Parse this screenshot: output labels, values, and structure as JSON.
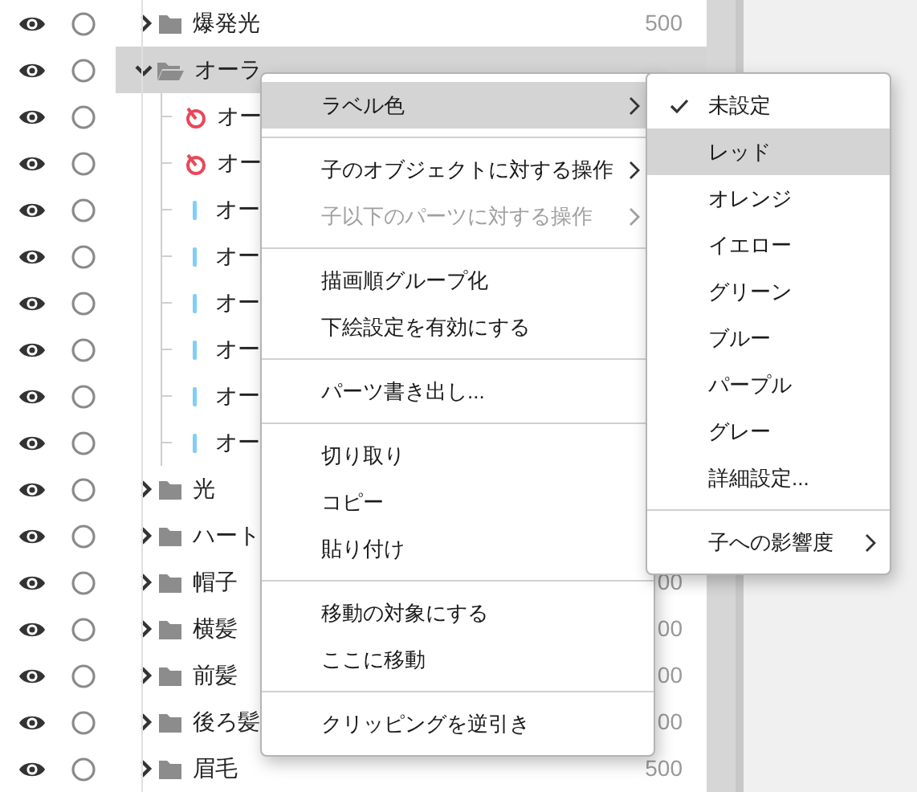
{
  "tree": {
    "rows": [
      {
        "kind": "folder",
        "visible": true,
        "expanded": false,
        "selected": false,
        "name": "爆発光",
        "value": "500"
      },
      {
        "kind": "folder",
        "visible": true,
        "expanded": true,
        "selected": true,
        "name": "オーラ",
        "children": [
          {
            "kind": "deformer",
            "visible": true,
            "selected": false,
            "name": "オー"
          },
          {
            "kind": "deformer",
            "visible": true,
            "selected": false,
            "name": "オー"
          },
          {
            "kind": "mesh",
            "visible": true,
            "selected": false,
            "name": "オー"
          },
          {
            "kind": "mesh",
            "visible": true,
            "selected": false,
            "name": "オー"
          },
          {
            "kind": "mesh",
            "visible": true,
            "selected": false,
            "name": "オー"
          },
          {
            "kind": "mesh",
            "visible": true,
            "selected": false,
            "name": "オー"
          },
          {
            "kind": "mesh",
            "visible": true,
            "selected": false,
            "name": "オー"
          },
          {
            "kind": "mesh",
            "visible": true,
            "selected": false,
            "name": "オー"
          }
        ]
      },
      {
        "kind": "folder",
        "visible": true,
        "expanded": false,
        "selected": false,
        "name": "光"
      },
      {
        "kind": "folder",
        "visible": true,
        "expanded": false,
        "selected": false,
        "name": "ハート"
      },
      {
        "kind": "folder",
        "visible": true,
        "expanded": false,
        "selected": false,
        "name": "帽子",
        "value": "00"
      },
      {
        "kind": "folder",
        "visible": true,
        "expanded": false,
        "selected": false,
        "name": "横髪",
        "value": "00"
      },
      {
        "kind": "folder",
        "visible": true,
        "expanded": false,
        "selected": false,
        "name": "前髪",
        "value": "00"
      },
      {
        "kind": "folder",
        "visible": true,
        "expanded": false,
        "selected": false,
        "name": "後ろ髪",
        "value": "00"
      },
      {
        "kind": "folder",
        "visible": true,
        "expanded": false,
        "selected": false,
        "name": "眉毛",
        "value": "500"
      }
    ]
  },
  "context_menu": {
    "items": [
      {
        "kind": "item",
        "label": "ラベル色",
        "submenu": true,
        "disabled": false,
        "selected": true
      },
      {
        "kind": "separator"
      },
      {
        "kind": "item",
        "label": "子のオブジェクトに対する操作",
        "submenu": true,
        "disabled": false,
        "selected": false
      },
      {
        "kind": "item",
        "label": "子以下のパーツに対する操作",
        "submenu": true,
        "disabled": true,
        "selected": false
      },
      {
        "kind": "separator"
      },
      {
        "kind": "item",
        "label": "描画順グループ化",
        "submenu": false,
        "disabled": false,
        "selected": false
      },
      {
        "kind": "item",
        "label": "下絵設定を有効にする",
        "submenu": false,
        "disabled": false,
        "selected": false
      },
      {
        "kind": "separator"
      },
      {
        "kind": "item",
        "label": "パーツ書き出し...",
        "submenu": false,
        "disabled": false,
        "selected": false
      },
      {
        "kind": "separator"
      },
      {
        "kind": "item",
        "label": "切り取り",
        "submenu": false,
        "disabled": false,
        "selected": false
      },
      {
        "kind": "item",
        "label": "コピー",
        "submenu": false,
        "disabled": false,
        "selected": false
      },
      {
        "kind": "item",
        "label": "貼り付け",
        "submenu": false,
        "disabled": false,
        "selected": false
      },
      {
        "kind": "separator"
      },
      {
        "kind": "item",
        "label": "移動の対象にする",
        "submenu": false,
        "disabled": false,
        "selected": false
      },
      {
        "kind": "item",
        "label": "ここに移動",
        "submenu": false,
        "disabled": false,
        "selected": false
      },
      {
        "kind": "separator"
      },
      {
        "kind": "item",
        "label": "クリッピングを逆引き",
        "submenu": false,
        "disabled": false,
        "selected": false
      }
    ]
  },
  "submenu": {
    "items": [
      {
        "kind": "item",
        "label": "未設定",
        "checked": true,
        "submenu": false,
        "selected": false
      },
      {
        "kind": "item",
        "label": "レッド",
        "checked": false,
        "submenu": false,
        "selected": true
      },
      {
        "kind": "item",
        "label": "オレンジ",
        "checked": false,
        "submenu": false,
        "selected": false
      },
      {
        "kind": "item",
        "label": "イエロー",
        "checked": false,
        "submenu": false,
        "selected": false
      },
      {
        "kind": "item",
        "label": "グリーン",
        "checked": false,
        "submenu": false,
        "selected": false
      },
      {
        "kind": "item",
        "label": "ブルー",
        "checked": false,
        "submenu": false,
        "selected": false
      },
      {
        "kind": "item",
        "label": "パープル",
        "checked": false,
        "submenu": false,
        "selected": false
      },
      {
        "kind": "item",
        "label": "グレー",
        "checked": false,
        "submenu": false,
        "selected": false
      },
      {
        "kind": "item",
        "label": "詳細設定...",
        "checked": false,
        "submenu": false,
        "selected": false
      },
      {
        "kind": "separator"
      },
      {
        "kind": "item",
        "label": "子への影響度",
        "checked": false,
        "submenu": true,
        "selected": false
      }
    ]
  }
}
